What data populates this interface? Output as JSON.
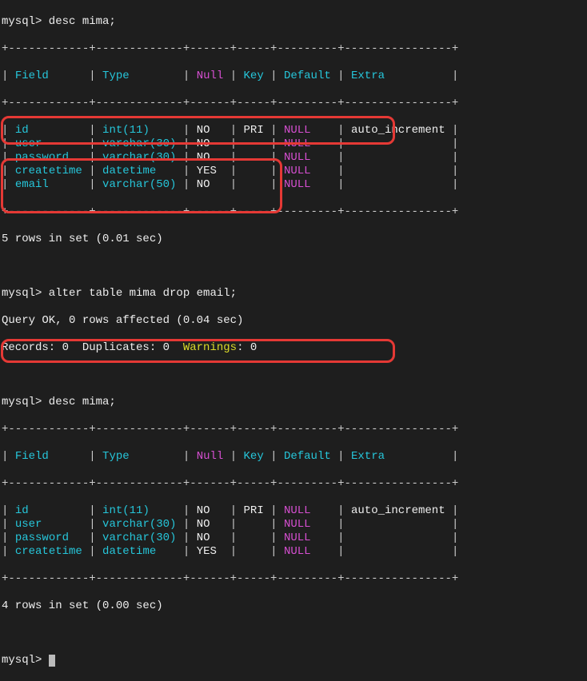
{
  "prompt1": "mysql> desc mima;",
  "table1": {
    "border_top": "+------------+-------------+------+-----+---------+----------------+",
    "header_pipe": "|",
    "header": {
      "field": "Field",
      "type": "Type",
      "null": "Null",
      "key": "Key",
      "default": "Default",
      "extra": "Extra"
    },
    "border_mid": "+------------+-------------+------+-----+---------+----------------+",
    "rows": [
      {
        "field": "id",
        "type": "int(11)",
        "null": "NO",
        "key": "PRI",
        "default": "NULL",
        "extra": "auto_increment"
      },
      {
        "field": "user",
        "type": "varchar(30)",
        "null": "NO",
        "key": "",
        "default": "NULL",
        "extra": ""
      },
      {
        "field": "password",
        "type": "varchar(30)",
        "null": "NO",
        "key": "",
        "default": "NULL",
        "extra": ""
      },
      {
        "field": "createtime",
        "type": "datetime",
        "null": "YES",
        "key": "",
        "default": "NULL",
        "extra": ""
      },
      {
        "field": "email",
        "type": "varchar(50)",
        "null": "NO",
        "key": "",
        "default": "NULL",
        "extra": ""
      }
    ],
    "border_bot": "+------------+-------------+------+-----+---------+----------------+"
  },
  "result1": "5 rows in set (0.01 sec)",
  "prompt2": "mysql> alter table mima drop email;",
  "affect": "Query OK, 0 rows affected (0.04 sec)",
  "records_pre": "Records: 0  Duplicates: 0  ",
  "warnings_lbl": "Warnings",
  "warnings_val": ": 0",
  "prompt3": "mysql> desc mima;",
  "table2": {
    "border_top": "+------------+-------------+------+-----+---------+----------------+",
    "header_pipe": "|",
    "border_mid": "+------------+-------------+------+-----+---------+----------------+",
    "rows": [
      {
        "field": "id",
        "type": "int(11)",
        "null": "NO",
        "key": "PRI",
        "default": "NULL",
        "extra": "auto_increment"
      },
      {
        "field": "user",
        "type": "varchar(30)",
        "null": "NO",
        "key": "",
        "default": "NULL",
        "extra": ""
      },
      {
        "field": "password",
        "type": "varchar(30)",
        "null": "NO",
        "key": "",
        "default": "NULL",
        "extra": ""
      },
      {
        "field": "createtime",
        "type": "datetime",
        "null": "YES",
        "key": "",
        "default": "NULL",
        "extra": ""
      }
    ],
    "border_bot": "+------------+-------------+------+-----+---------+----------------+"
  },
  "result2": "4 rows in set (0.00 sec)",
  "prompt4": "mysql> ",
  "col_widths": {
    "field": 10,
    "type": 11,
    "null": 4,
    "key": 3,
    "default": 7,
    "extra": 14
  }
}
